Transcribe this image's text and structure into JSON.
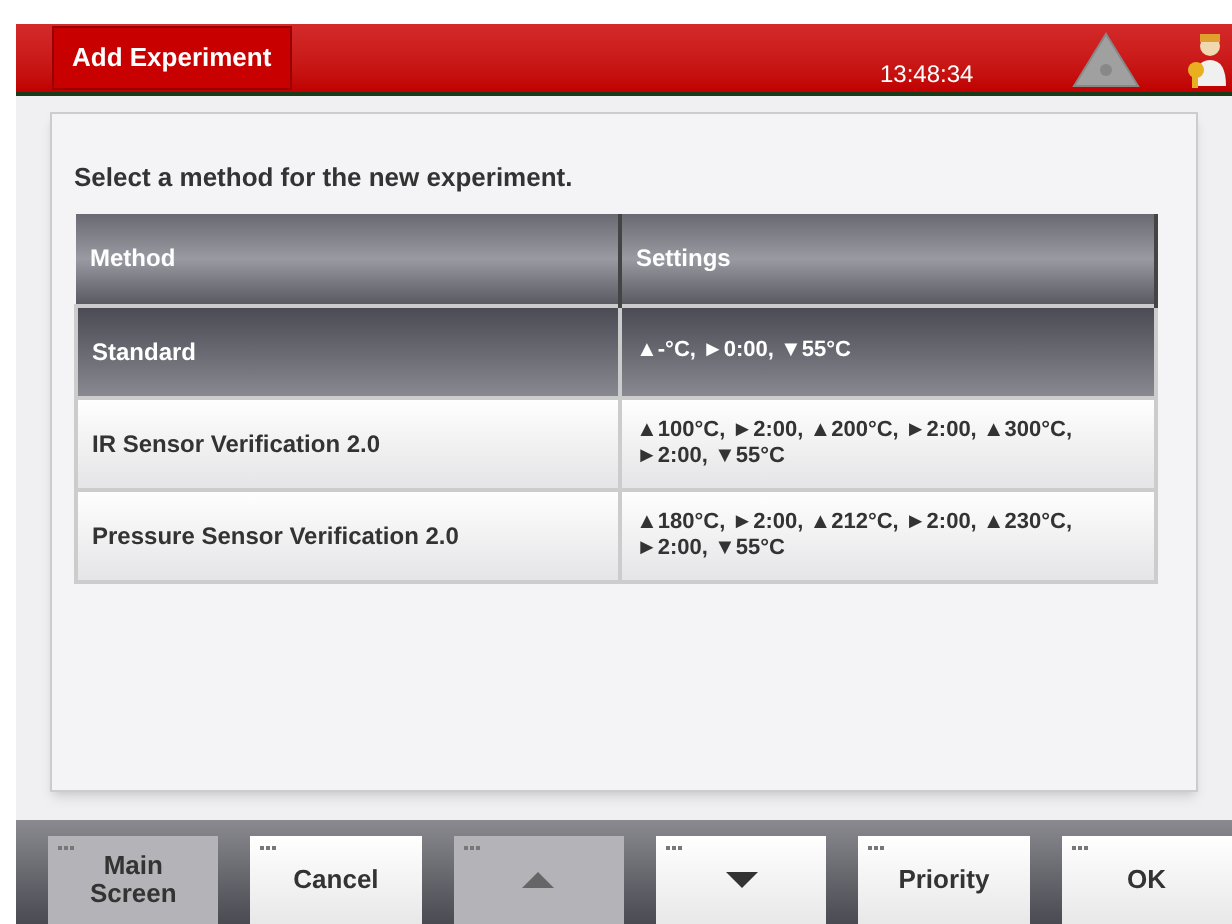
{
  "header": {
    "title": "Add Experiment",
    "time": "13:48:34"
  },
  "prompt": "Select a method for the new experiment.",
  "table": {
    "columns": [
      "Method",
      "Settings"
    ],
    "rows": [
      {
        "method": "Standard",
        "settings": "▲-°C, ►0:00, ▼55°C",
        "selected": true
      },
      {
        "method": "IR Sensor Verification 2.0",
        "settings": "▲100°C, ►2:00, ▲200°C, ►2:00, ▲300°C, ►2:00, ▼55°C",
        "selected": false
      },
      {
        "method": "Pressure Sensor Verification 2.0",
        "settings": "▲180°C, ►2:00, ▲212°C, ►2:00, ▲230°C, ►2:00, ▼55°C",
        "selected": false
      }
    ]
  },
  "buttons": [
    {
      "kind": "text",
      "label": "Main Screen",
      "disabled": true
    },
    {
      "kind": "text",
      "label": "Cancel",
      "disabled": false
    },
    {
      "kind": "up",
      "disabled": true
    },
    {
      "kind": "down",
      "disabled": false
    },
    {
      "kind": "text",
      "label": "Priority",
      "disabled": false
    },
    {
      "kind": "text",
      "label": "OK",
      "disabled": false
    }
  ]
}
